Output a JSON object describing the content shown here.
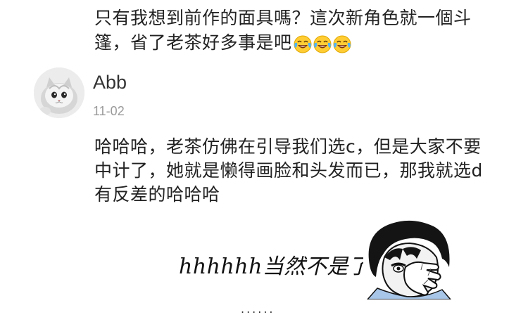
{
  "previous_comment": {
    "line1": "只有我想到前作的面具嗎？這次新角色就一個斗",
    "line2": "篷，省了老茶好多事是吧",
    "emojis": [
      "tears-of-joy",
      "tears-of-joy",
      "tears-of-joy"
    ]
  },
  "comment": {
    "username": "Abb",
    "date": "11-02",
    "avatar": "cat-avatar",
    "text_line1": "哈哈哈，老茶仿佛在引导我们选c，但是大家不要",
    "text_line2": "中计了，她就是懒得画脸和头发而已，那我就选d",
    "text_line3": "有反差的哈哈哈"
  },
  "sticker": {
    "caption": "hhhhhh当然不是了!",
    "ellipsis": "......",
    "image": "facepalm-anime-character"
  }
}
